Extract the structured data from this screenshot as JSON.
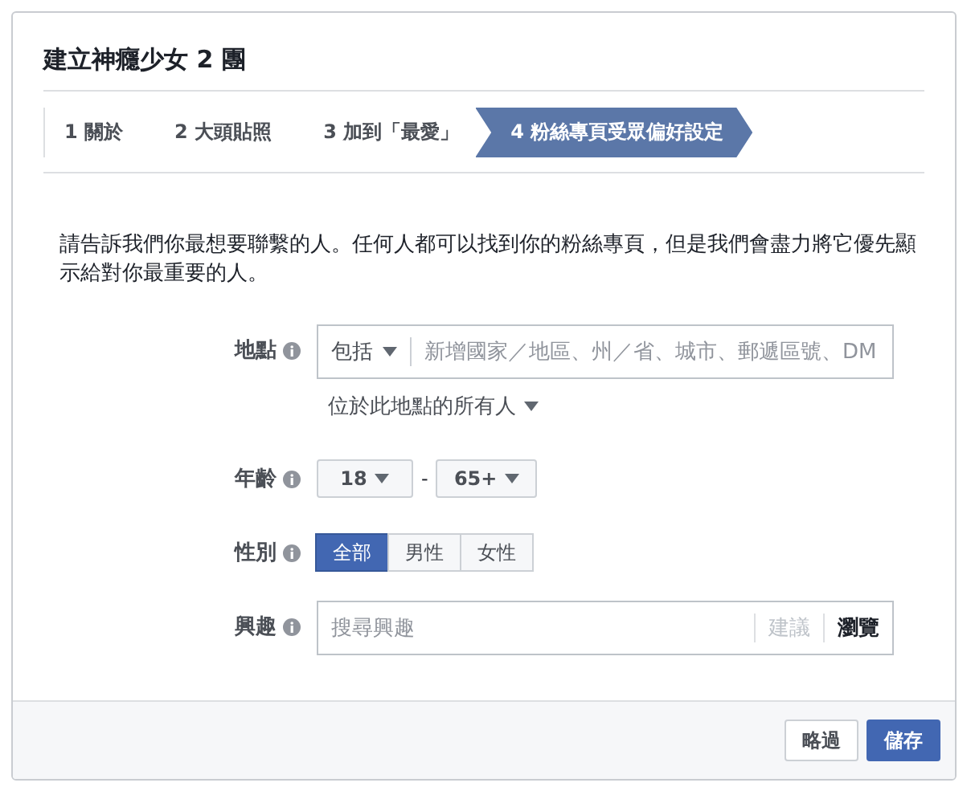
{
  "dialog": {
    "title": "建立神癮少女 2 團"
  },
  "steps": [
    {
      "label": "1 關於",
      "selected": false
    },
    {
      "label": "2 大頭貼照",
      "selected": false
    },
    {
      "label": "3 加到「最愛」",
      "selected": false
    },
    {
      "label": "4 粉絲專頁受眾偏好設定",
      "selected": true
    }
  ],
  "description": "請告訴我們你最想要聯繫的人。任何人都可以找到你的粉絲專頁，但是我們會盡力將它優先顯示給對你最重要的人。",
  "location": {
    "label": "地點",
    "include": "包括",
    "placeholder": "新增國家／地區、州／省、城市、郵遞區號、DM",
    "scope": "位於此地點的所有人"
  },
  "age": {
    "label": "年齡",
    "min": "18",
    "separator": "-",
    "max": "65+"
  },
  "gender": {
    "label": "性別",
    "options": [
      {
        "label": "全部",
        "selected": true
      },
      {
        "label": "男性",
        "selected": false
      },
      {
        "label": "女性",
        "selected": false
      }
    ]
  },
  "interests": {
    "label": "興趣",
    "placeholder": "搜尋興趣",
    "suggest": "建議",
    "browse": "瀏覽"
  },
  "buttons": [
    {
      "label": "略過",
      "kind": "secondary"
    },
    {
      "label": "儲存",
      "kind": "primary"
    }
  ]
}
